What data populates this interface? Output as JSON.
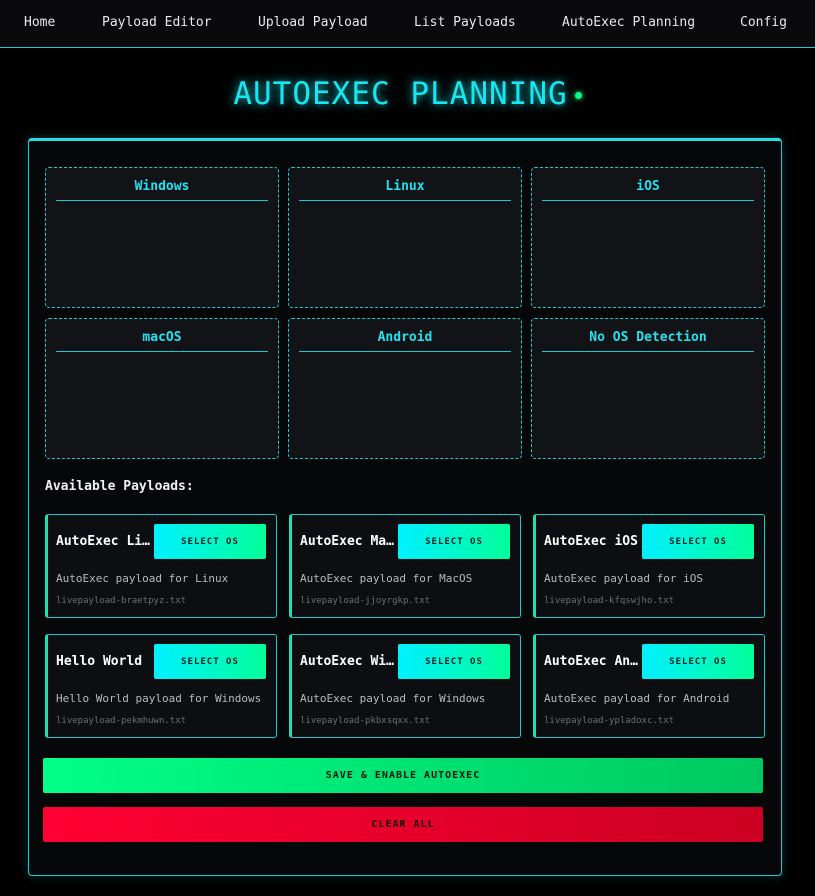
{
  "nav": {
    "items": [
      "Home",
      "Payload Editor",
      "Upload Payload",
      "List Payloads",
      "AutoExec Planning",
      "Config"
    ]
  },
  "page": {
    "title": "AUTOEXEC PLANNING"
  },
  "os_slots": [
    "Windows",
    "Linux",
    "iOS",
    "macOS",
    "Android",
    "No OS Detection"
  ],
  "available": {
    "label": "Available Payloads:",
    "select_label": "SELECT OS",
    "payloads": [
      {
        "name": "AutoExec Linux",
        "desc": "AutoExec payload for Linux",
        "file": "livepayload-braetpyz.txt"
      },
      {
        "name": "AutoExec MacOS",
        "desc": "AutoExec payload for MacOS",
        "file": "livepayload-jjoyrgkp.txt"
      },
      {
        "name": "AutoExec iOS",
        "desc": "AutoExec payload for iOS",
        "file": "livepayload-kfqswjho.txt"
      },
      {
        "name": "Hello World",
        "desc": "Hello World payload for Windows",
        "file": "livepayload-pekmhuwn.txt"
      },
      {
        "name": "AutoExec Windows",
        "desc": "AutoExec payload for Windows",
        "file": "livepayload-pkbxsqxx.txt"
      },
      {
        "name": "AutoExec Android",
        "desc": "AutoExec payload for Android",
        "file": "livepayload-ypladoxc.txt"
      }
    ]
  },
  "actions": {
    "save_label": "SAVE & ENABLE AUTOEXEC",
    "clear_label": "CLEAR ALL"
  },
  "colors": {
    "accent": "#1fc8d0",
    "title": "#16e8f2",
    "save": "#00ff88",
    "clear": "#ff0033"
  }
}
